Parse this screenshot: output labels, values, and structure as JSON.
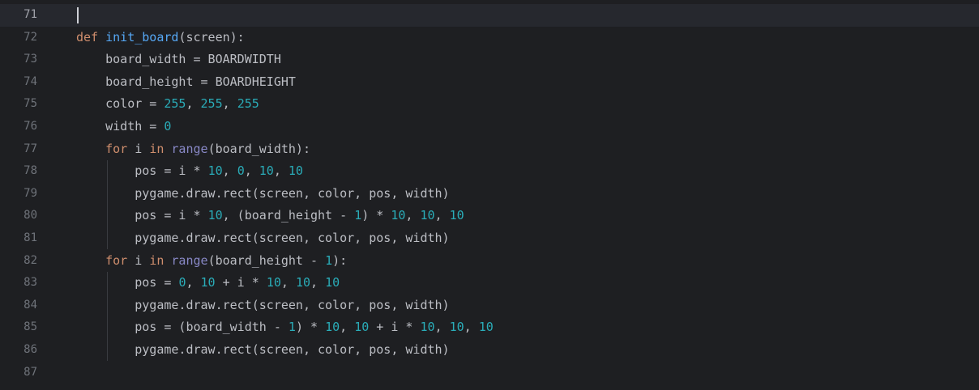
{
  "editor": {
    "lines": [
      {
        "number": "71",
        "current": true,
        "tokens": []
      },
      {
        "number": "72",
        "tokens": [
          {
            "t": "def",
            "c": "kw"
          },
          {
            "t": " "
          },
          {
            "t": "init_board",
            "c": "fn"
          },
          {
            "t": "(screen):"
          }
        ]
      },
      {
        "number": "73",
        "tokens": [
          {
            "t": "    board_width = BOARDWIDTH"
          }
        ]
      },
      {
        "number": "74",
        "tokens": [
          {
            "t": "    board_height = BOARDHEIGHT"
          }
        ]
      },
      {
        "number": "75",
        "tokens": [
          {
            "t": "    color = "
          },
          {
            "t": "255",
            "c": "num"
          },
          {
            "t": ", "
          },
          {
            "t": "255",
            "c": "num"
          },
          {
            "t": ", "
          },
          {
            "t": "255",
            "c": "num"
          }
        ]
      },
      {
        "number": "76",
        "tokens": [
          {
            "t": "    width = "
          },
          {
            "t": "0",
            "c": "num"
          }
        ]
      },
      {
        "number": "77",
        "tokens": [
          {
            "t": "    "
          },
          {
            "t": "for",
            "c": "kw"
          },
          {
            "t": " i "
          },
          {
            "t": "in",
            "c": "kw"
          },
          {
            "t": " "
          },
          {
            "t": "range",
            "c": "bi"
          },
          {
            "t": "(board_width):"
          }
        ]
      },
      {
        "number": "78",
        "tokens": [
          {
            "t": "        pos = i * "
          },
          {
            "t": "10",
            "c": "num"
          },
          {
            "t": ", "
          },
          {
            "t": "0",
            "c": "num"
          },
          {
            "t": ", "
          },
          {
            "t": "10",
            "c": "num"
          },
          {
            "t": ", "
          },
          {
            "t": "10",
            "c": "num"
          }
        ]
      },
      {
        "number": "79",
        "tokens": [
          {
            "t": "        pygame.draw.rect(screen, color, pos, width)"
          }
        ]
      },
      {
        "number": "80",
        "tokens": [
          {
            "t": "        pos = i * "
          },
          {
            "t": "10",
            "c": "num"
          },
          {
            "t": ", (board_height - "
          },
          {
            "t": "1",
            "c": "num"
          },
          {
            "t": ") * "
          },
          {
            "t": "10",
            "c": "num"
          },
          {
            "t": ", "
          },
          {
            "t": "10",
            "c": "num"
          },
          {
            "t": ", "
          },
          {
            "t": "10",
            "c": "num"
          }
        ]
      },
      {
        "number": "81",
        "tokens": [
          {
            "t": "        pygame.draw.rect(screen, color, pos, width)"
          }
        ]
      },
      {
        "number": "82",
        "tokens": [
          {
            "t": "    "
          },
          {
            "t": "for",
            "c": "kw"
          },
          {
            "t": " i "
          },
          {
            "t": "in",
            "c": "kw"
          },
          {
            "t": " "
          },
          {
            "t": "range",
            "c": "bi"
          },
          {
            "t": "(board_height - "
          },
          {
            "t": "1",
            "c": "num"
          },
          {
            "t": "):"
          }
        ]
      },
      {
        "number": "83",
        "tokens": [
          {
            "t": "        pos = "
          },
          {
            "t": "0",
            "c": "num"
          },
          {
            "t": ", "
          },
          {
            "t": "10",
            "c": "num"
          },
          {
            "t": " + i * "
          },
          {
            "t": "10",
            "c": "num"
          },
          {
            "t": ", "
          },
          {
            "t": "10",
            "c": "num"
          },
          {
            "t": ", "
          },
          {
            "t": "10",
            "c": "num"
          }
        ]
      },
      {
        "number": "84",
        "tokens": [
          {
            "t": "        pygame.draw.rect(screen, color, pos, width)"
          }
        ]
      },
      {
        "number": "85",
        "tokens": [
          {
            "t": "        pos = (board_width - "
          },
          {
            "t": "1",
            "c": "num"
          },
          {
            "t": ") * "
          },
          {
            "t": "10",
            "c": "num"
          },
          {
            "t": ", "
          },
          {
            "t": "10",
            "c": "num"
          },
          {
            "t": " + i * "
          },
          {
            "t": "10",
            "c": "num"
          },
          {
            "t": ", "
          },
          {
            "t": "10",
            "c": "num"
          },
          {
            "t": ", "
          },
          {
            "t": "10",
            "c": "num"
          }
        ]
      },
      {
        "number": "86",
        "tokens": [
          {
            "t": "        pygame.draw.rect(screen, color, pos, width)"
          }
        ]
      },
      {
        "number": "87",
        "tokens": []
      }
    ]
  },
  "colors": {
    "background": "#1e1f22",
    "current_line": "#26282e",
    "keyword": "#cf8e6d",
    "function_name": "#56a8f5",
    "builtin": "#8888c6",
    "number": "#2aacb8",
    "text": "#bcbec4",
    "line_number": "#6f737a"
  }
}
